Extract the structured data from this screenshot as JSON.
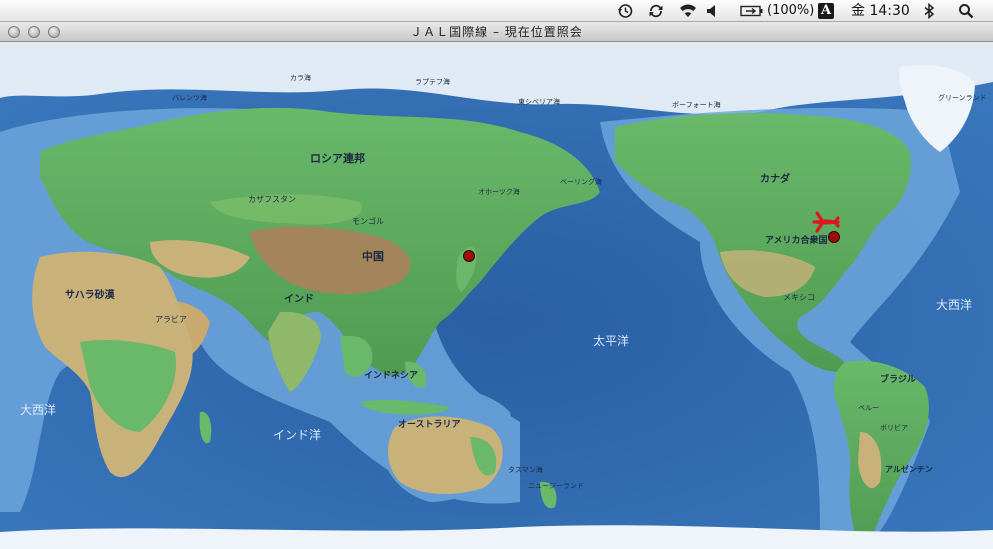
{
  "menubar": {
    "icons": [
      "time-machine-icon",
      "sync-icon",
      "wifi-icon",
      "volume-icon",
      "battery-icon",
      "input-method-icon",
      "bluetooth-icon",
      "spotlight-icon"
    ],
    "battery_text": "(100%)",
    "input_method_glyph": "A",
    "clock": "金 14:30"
  },
  "window": {
    "title": "ＪＡＬ国際線 – 現在位置照会"
  },
  "map": {
    "oceans": {
      "pacific": "太平洋",
      "atlantic_left": "大西洋",
      "atlantic_right": "大西洋",
      "indian": "インド洋"
    },
    "regions": {
      "russia": "ロシア連邦",
      "china": "中国",
      "mongolia": "モンゴル",
      "kazakhstan": "カザフスタン",
      "india": "インド",
      "sahara": "サハラ砂漠",
      "australia": "オーストラリア",
      "canada": "カナダ",
      "usa": "アメリカ合衆国",
      "brazil": "ブラジル",
      "mexico": "メキシコ",
      "greenland": "グリーンランド",
      "indonesia": "インドネシア",
      "argentina": "アルゼンチン",
      "bolivia": "ボリビア",
      "peru": "ペルー",
      "kara_sea": "カラ海",
      "laptev_sea": "ラプテフ海",
      "east_siberian_sea": "東シベリア海",
      "barents_sea": "バレンツ海",
      "beaufort_sea": "ボーフォート海",
      "okhotsk": "オホーツク海",
      "bering": "ベーリング海",
      "tasman": "タスマン海",
      "new_zealand": "ニュージーランド",
      "arabia": "アラビア"
    },
    "colors": {
      "ocean_deep": "#2c63a6",
      "ocean_shallow": "#7fb3e0",
      "land_green": "#5aa85a",
      "land_tan": "#c9b27a",
      "ice": "#eef4fa",
      "marker": "#9b0d0d",
      "plane": "#e0141c"
    }
  }
}
